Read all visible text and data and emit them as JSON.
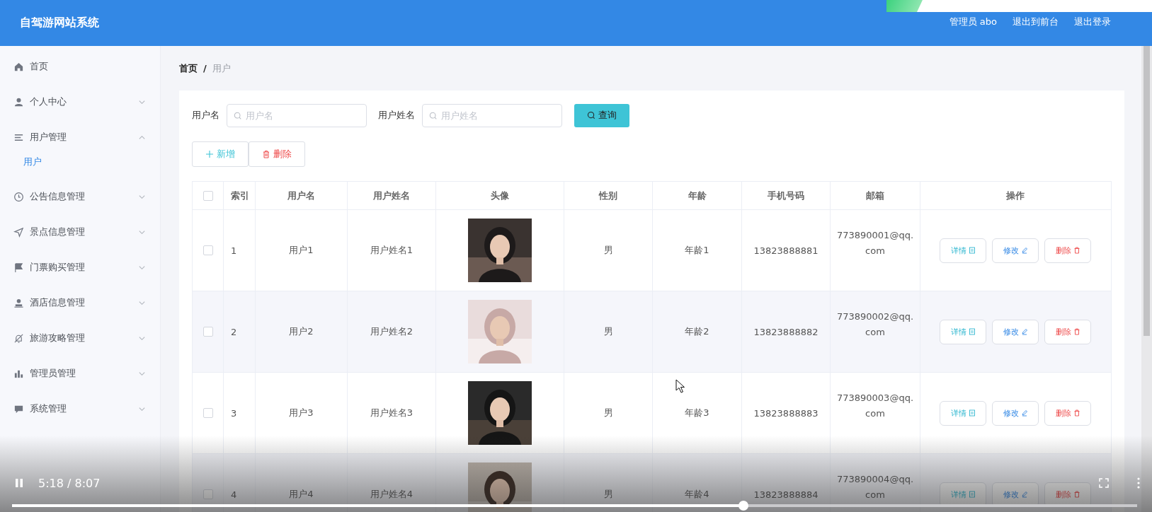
{
  "header": {
    "title": "自驾游网站系统",
    "user": "管理员 abo",
    "links": [
      "退出到前台",
      "退出登录"
    ]
  },
  "sidebar": {
    "items": [
      {
        "label": "首页",
        "kind": "link"
      },
      {
        "label": "个人中心",
        "kind": "menu",
        "expanded": false
      },
      {
        "label": "用户管理",
        "kind": "menu",
        "expanded": true,
        "children": [
          {
            "label": "用户",
            "selected": true
          }
        ]
      },
      {
        "label": "公告信息管理",
        "kind": "menu",
        "expanded": false
      },
      {
        "label": "景点信息管理",
        "kind": "menu",
        "expanded": false
      },
      {
        "label": "门票购买管理",
        "kind": "menu",
        "expanded": false
      },
      {
        "label": "酒店信息管理",
        "kind": "menu",
        "expanded": false
      },
      {
        "label": "旅游攻略管理",
        "kind": "menu",
        "expanded": false
      },
      {
        "label": "管理员管理",
        "kind": "menu",
        "expanded": false
      },
      {
        "label": "系统管理",
        "kind": "menu",
        "expanded": false
      }
    ]
  },
  "breadcrumb": {
    "items": [
      "首页",
      "用户"
    ],
    "separator": "/"
  },
  "search": {
    "fields": [
      {
        "label": "用户名",
        "placeholder": "用户名"
      },
      {
        "label": "用户姓名",
        "placeholder": "用户姓名"
      }
    ],
    "button": "查询"
  },
  "actions": [
    {
      "label": "新增",
      "kind": "add"
    },
    {
      "label": "删除",
      "kind": "delete"
    }
  ],
  "table": {
    "select_all": {
      "checked": false
    },
    "columns": [
      "索引",
      "用户名",
      "用户姓名",
      "头像",
      "性别",
      "年龄",
      "手机号码",
      "邮箱",
      "操作"
    ],
    "rows": [
      {
        "checked": false,
        "index": "1",
        "username": "用户1",
        "name": "用户姓名1",
        "avatar": {
          "kind": "picture"
        },
        "gender": "男",
        "age": "年龄1",
        "phone": "13823888881",
        "email": "773890001@qq.com",
        "buttons": [
          {
            "label": "详情",
            "kind": "detail"
          },
          {
            "label": "修改",
            "kind": "edit"
          },
          {
            "label": "删除",
            "kind": "delete"
          }
        ]
      },
      {
        "checked": false,
        "index": "2",
        "username": "用户2",
        "name": "用户姓名2",
        "avatar": {
          "kind": "picture"
        },
        "gender": "男",
        "age": "年龄2",
        "phone": "13823888882",
        "email": "773890002@qq.com",
        "buttons": [
          {
            "label": "详情",
            "kind": "detail"
          },
          {
            "label": "修改",
            "kind": "edit"
          },
          {
            "label": "删除",
            "kind": "delete"
          }
        ]
      },
      {
        "checked": false,
        "index": "3",
        "username": "用户3",
        "name": "用户姓名3",
        "avatar": {
          "kind": "picture"
        },
        "gender": "男",
        "age": "年龄3",
        "phone": "13823888883",
        "email": "773890003@qq.com",
        "buttons": [
          {
            "label": "详情",
            "kind": "detail"
          },
          {
            "label": "修改",
            "kind": "edit"
          },
          {
            "label": "删除",
            "kind": "delete"
          }
        ]
      },
      {
        "checked": false,
        "index": "4",
        "username": "用户4",
        "name": "用户姓名4",
        "avatar": {
          "kind": "picture"
        },
        "gender": "男",
        "age": "年龄4",
        "phone": "13823888884",
        "email": "773890004@qq.com",
        "buttons": [
          {
            "label": "详情",
            "kind": "detail"
          },
          {
            "label": "修改",
            "kind": "edit"
          },
          {
            "label": "删除",
            "kind": "delete"
          }
        ]
      }
    ]
  },
  "player": {
    "playing": true,
    "time": "5:18 / 8:07",
    "level": 0.65
  }
}
